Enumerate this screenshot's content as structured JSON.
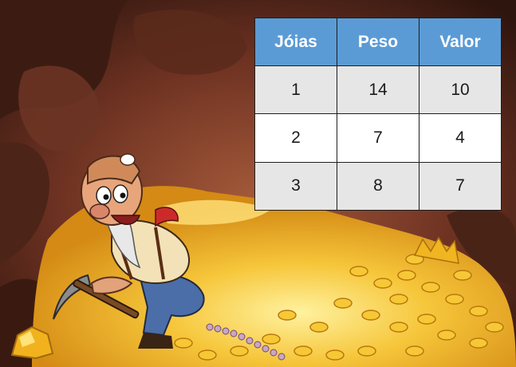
{
  "table": {
    "headers": [
      "Jóias",
      "Peso",
      "Valor"
    ],
    "rows": [
      [
        "1",
        "14",
        "10"
      ],
      [
        "2",
        "7",
        "4"
      ],
      [
        "3",
        "8",
        "7"
      ]
    ]
  },
  "colors": {
    "header_bg": "#5b9bd5",
    "header_text": "#ffffff",
    "row_odd": "#e6e6e6",
    "row_even": "#ffffff",
    "cave": "#4a2418",
    "gold": "#f2b71c"
  },
  "icons": [
    "cave-background",
    "gold-treasure-pile",
    "miner-character",
    "pickaxe-icon",
    "gem-necklace-icon",
    "gold-nugget-icon"
  ]
}
